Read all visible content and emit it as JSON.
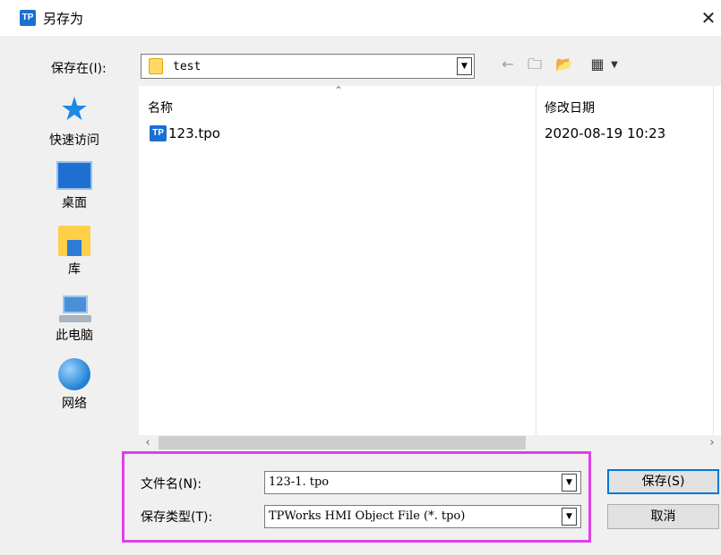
{
  "window": {
    "title": "另存为",
    "app_icon_text": "TP",
    "close_glyph": "✕"
  },
  "toolbar": {
    "save_in_label": "保存在(I):",
    "save_in_value": "test",
    "dropdown_glyph": "▼",
    "icons": [
      "back-arrow-icon",
      "up-folder-icon",
      "new-folder-icon",
      "view-menu-icon"
    ]
  },
  "places": [
    {
      "label": "快速访问",
      "icon": "star-icon"
    },
    {
      "label": "桌面",
      "icon": "desktop-icon"
    },
    {
      "label": "库",
      "icon": "library-icon"
    },
    {
      "label": "此电脑",
      "icon": "computer-icon"
    },
    {
      "label": "网络",
      "icon": "network-icon"
    }
  ],
  "file_list": {
    "columns": [
      "名称",
      "修改日期"
    ],
    "rows": [
      {
        "name": "123.tpo",
        "modified": "2020-08-19 10:23",
        "icon_text": "TP"
      }
    ]
  },
  "form": {
    "filename_label": "文件名(N):",
    "filename_value": "123-1. tpo",
    "filetype_label": "保存类型(T):",
    "filetype_value": "TPWorks HMI Object File (*. tpo)"
  },
  "buttons": {
    "save": "保存(S)",
    "cancel": "取消"
  },
  "colors": {
    "highlight": "#e040e8",
    "accent": "#0078d7",
    "app_icon": "#1a6fd4"
  }
}
